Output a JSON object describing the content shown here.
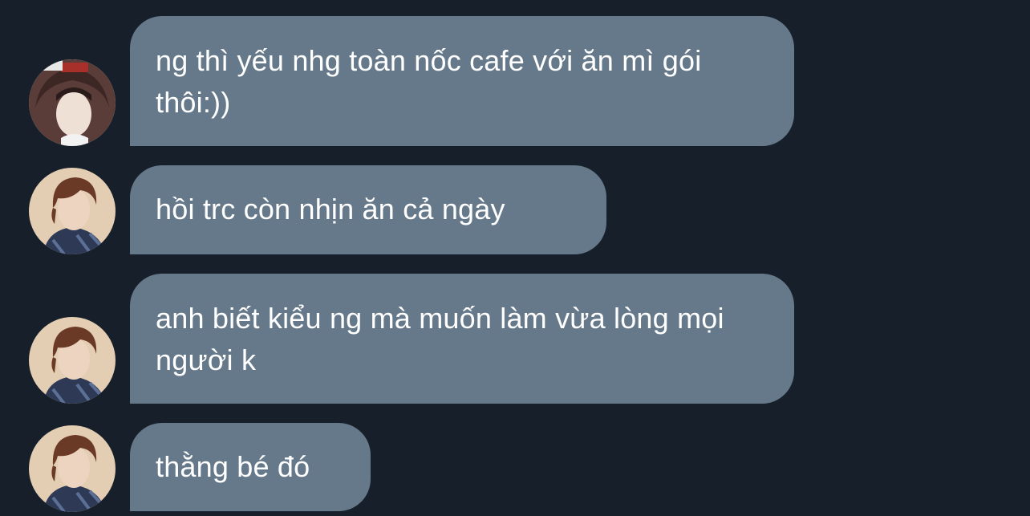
{
  "colors": {
    "background": "#17202a",
    "bubble": "#66798a",
    "text": "#ffffff"
  },
  "messages": [
    {
      "text": "ng thì yếu nhg toàn nốc cafe với ăn mì gói thôi:))",
      "avatar": "avatar-hooded"
    },
    {
      "text": "hồi trc còn nhịn ăn cả ngày",
      "avatar": "avatar-brown-hair"
    },
    {
      "text": "anh biết kiểu ng mà muốn làm vừa lòng mọi người k",
      "avatar": "avatar-brown-hair"
    },
    {
      "text": "thằng bé đó",
      "avatar": "avatar-brown-hair"
    }
  ]
}
